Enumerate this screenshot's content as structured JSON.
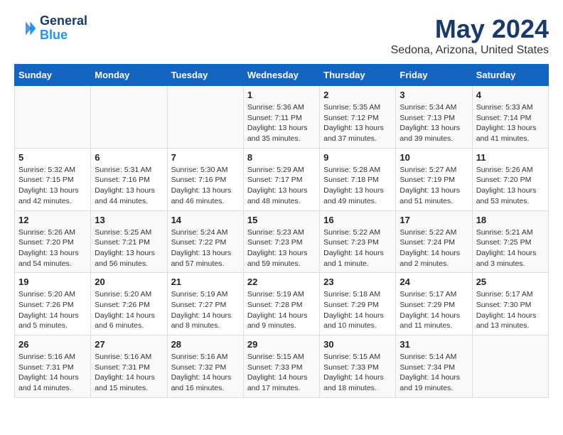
{
  "header": {
    "logo_line1": "General",
    "logo_line2": "Blue",
    "title": "May 2024",
    "subtitle": "Sedona, Arizona, United States"
  },
  "weekdays": [
    "Sunday",
    "Monday",
    "Tuesday",
    "Wednesday",
    "Thursday",
    "Friday",
    "Saturday"
  ],
  "weeks": [
    [
      {
        "day": "",
        "info": ""
      },
      {
        "day": "",
        "info": ""
      },
      {
        "day": "",
        "info": ""
      },
      {
        "day": "1",
        "info": "Sunrise: 5:36 AM\nSunset: 7:11 PM\nDaylight: 13 hours\nand 35 minutes."
      },
      {
        "day": "2",
        "info": "Sunrise: 5:35 AM\nSunset: 7:12 PM\nDaylight: 13 hours\nand 37 minutes."
      },
      {
        "day": "3",
        "info": "Sunrise: 5:34 AM\nSunset: 7:13 PM\nDaylight: 13 hours\nand 39 minutes."
      },
      {
        "day": "4",
        "info": "Sunrise: 5:33 AM\nSunset: 7:14 PM\nDaylight: 13 hours\nand 41 minutes."
      }
    ],
    [
      {
        "day": "5",
        "info": "Sunrise: 5:32 AM\nSunset: 7:15 PM\nDaylight: 13 hours\nand 42 minutes."
      },
      {
        "day": "6",
        "info": "Sunrise: 5:31 AM\nSunset: 7:16 PM\nDaylight: 13 hours\nand 44 minutes."
      },
      {
        "day": "7",
        "info": "Sunrise: 5:30 AM\nSunset: 7:16 PM\nDaylight: 13 hours\nand 46 minutes."
      },
      {
        "day": "8",
        "info": "Sunrise: 5:29 AM\nSunset: 7:17 PM\nDaylight: 13 hours\nand 48 minutes."
      },
      {
        "day": "9",
        "info": "Sunrise: 5:28 AM\nSunset: 7:18 PM\nDaylight: 13 hours\nand 49 minutes."
      },
      {
        "day": "10",
        "info": "Sunrise: 5:27 AM\nSunset: 7:19 PM\nDaylight: 13 hours\nand 51 minutes."
      },
      {
        "day": "11",
        "info": "Sunrise: 5:26 AM\nSunset: 7:20 PM\nDaylight: 13 hours\nand 53 minutes."
      }
    ],
    [
      {
        "day": "12",
        "info": "Sunrise: 5:26 AM\nSunset: 7:20 PM\nDaylight: 13 hours\nand 54 minutes."
      },
      {
        "day": "13",
        "info": "Sunrise: 5:25 AM\nSunset: 7:21 PM\nDaylight: 13 hours\nand 56 minutes."
      },
      {
        "day": "14",
        "info": "Sunrise: 5:24 AM\nSunset: 7:22 PM\nDaylight: 13 hours\nand 57 minutes."
      },
      {
        "day": "15",
        "info": "Sunrise: 5:23 AM\nSunset: 7:23 PM\nDaylight: 13 hours\nand 59 minutes."
      },
      {
        "day": "16",
        "info": "Sunrise: 5:22 AM\nSunset: 7:23 PM\nDaylight: 14 hours\nand 1 minute."
      },
      {
        "day": "17",
        "info": "Sunrise: 5:22 AM\nSunset: 7:24 PM\nDaylight: 14 hours\nand 2 minutes."
      },
      {
        "day": "18",
        "info": "Sunrise: 5:21 AM\nSunset: 7:25 PM\nDaylight: 14 hours\nand 3 minutes."
      }
    ],
    [
      {
        "day": "19",
        "info": "Sunrise: 5:20 AM\nSunset: 7:26 PM\nDaylight: 14 hours\nand 5 minutes."
      },
      {
        "day": "20",
        "info": "Sunrise: 5:20 AM\nSunset: 7:26 PM\nDaylight: 14 hours\nand 6 minutes."
      },
      {
        "day": "21",
        "info": "Sunrise: 5:19 AM\nSunset: 7:27 PM\nDaylight: 14 hours\nand 8 minutes."
      },
      {
        "day": "22",
        "info": "Sunrise: 5:19 AM\nSunset: 7:28 PM\nDaylight: 14 hours\nand 9 minutes."
      },
      {
        "day": "23",
        "info": "Sunrise: 5:18 AM\nSunset: 7:29 PM\nDaylight: 14 hours\nand 10 minutes."
      },
      {
        "day": "24",
        "info": "Sunrise: 5:17 AM\nSunset: 7:29 PM\nDaylight: 14 hours\nand 11 minutes."
      },
      {
        "day": "25",
        "info": "Sunrise: 5:17 AM\nSunset: 7:30 PM\nDaylight: 14 hours\nand 13 minutes."
      }
    ],
    [
      {
        "day": "26",
        "info": "Sunrise: 5:16 AM\nSunset: 7:31 PM\nDaylight: 14 hours\nand 14 minutes."
      },
      {
        "day": "27",
        "info": "Sunrise: 5:16 AM\nSunset: 7:31 PM\nDaylight: 14 hours\nand 15 minutes."
      },
      {
        "day": "28",
        "info": "Sunrise: 5:16 AM\nSunset: 7:32 PM\nDaylight: 14 hours\nand 16 minutes."
      },
      {
        "day": "29",
        "info": "Sunrise: 5:15 AM\nSunset: 7:33 PM\nDaylight: 14 hours\nand 17 minutes."
      },
      {
        "day": "30",
        "info": "Sunrise: 5:15 AM\nSunset: 7:33 PM\nDaylight: 14 hours\nand 18 minutes."
      },
      {
        "day": "31",
        "info": "Sunrise: 5:14 AM\nSunset: 7:34 PM\nDaylight: 14 hours\nand 19 minutes."
      },
      {
        "day": "",
        "info": ""
      }
    ]
  ]
}
